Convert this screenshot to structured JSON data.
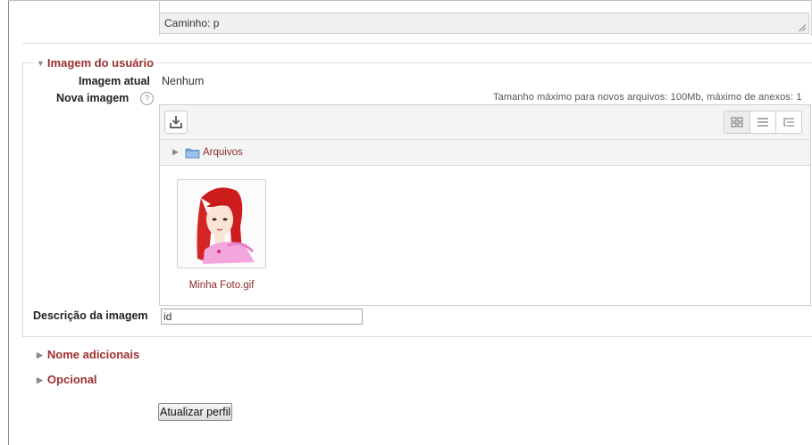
{
  "editor": {
    "path_label": "Caminho: p"
  },
  "user_image_section": {
    "legend": "Imagem do usuário",
    "current_image_label": "Imagem atual",
    "current_image_value": "Nenhum",
    "new_image_label": "Nova imagem",
    "help_icon": "?",
    "max_size_text": "Tamanho máximo para novos arquivos: 100Mb, máximo de anexos: 1",
    "file_picker": {
      "toolbar": {
        "download_icon": "download-icon",
        "view_icons": [
          "grid-view-icon",
          "list-view-icon",
          "tree-view-icon"
        ]
      },
      "breadcrumb": {
        "folder_label": "Arquivos"
      },
      "files": [
        {
          "name": "Minha Foto.gif"
        }
      ]
    },
    "description_label": "Descrição da imagem",
    "description_value": "id"
  },
  "collapsed_sections": [
    {
      "label": "Nome adicionais"
    },
    {
      "label": "Opcional"
    }
  ],
  "submit": {
    "label": "Atualizar perfil"
  },
  "colors": {
    "section_heading": "#9c2f2f",
    "link": "#8a2b2b"
  }
}
